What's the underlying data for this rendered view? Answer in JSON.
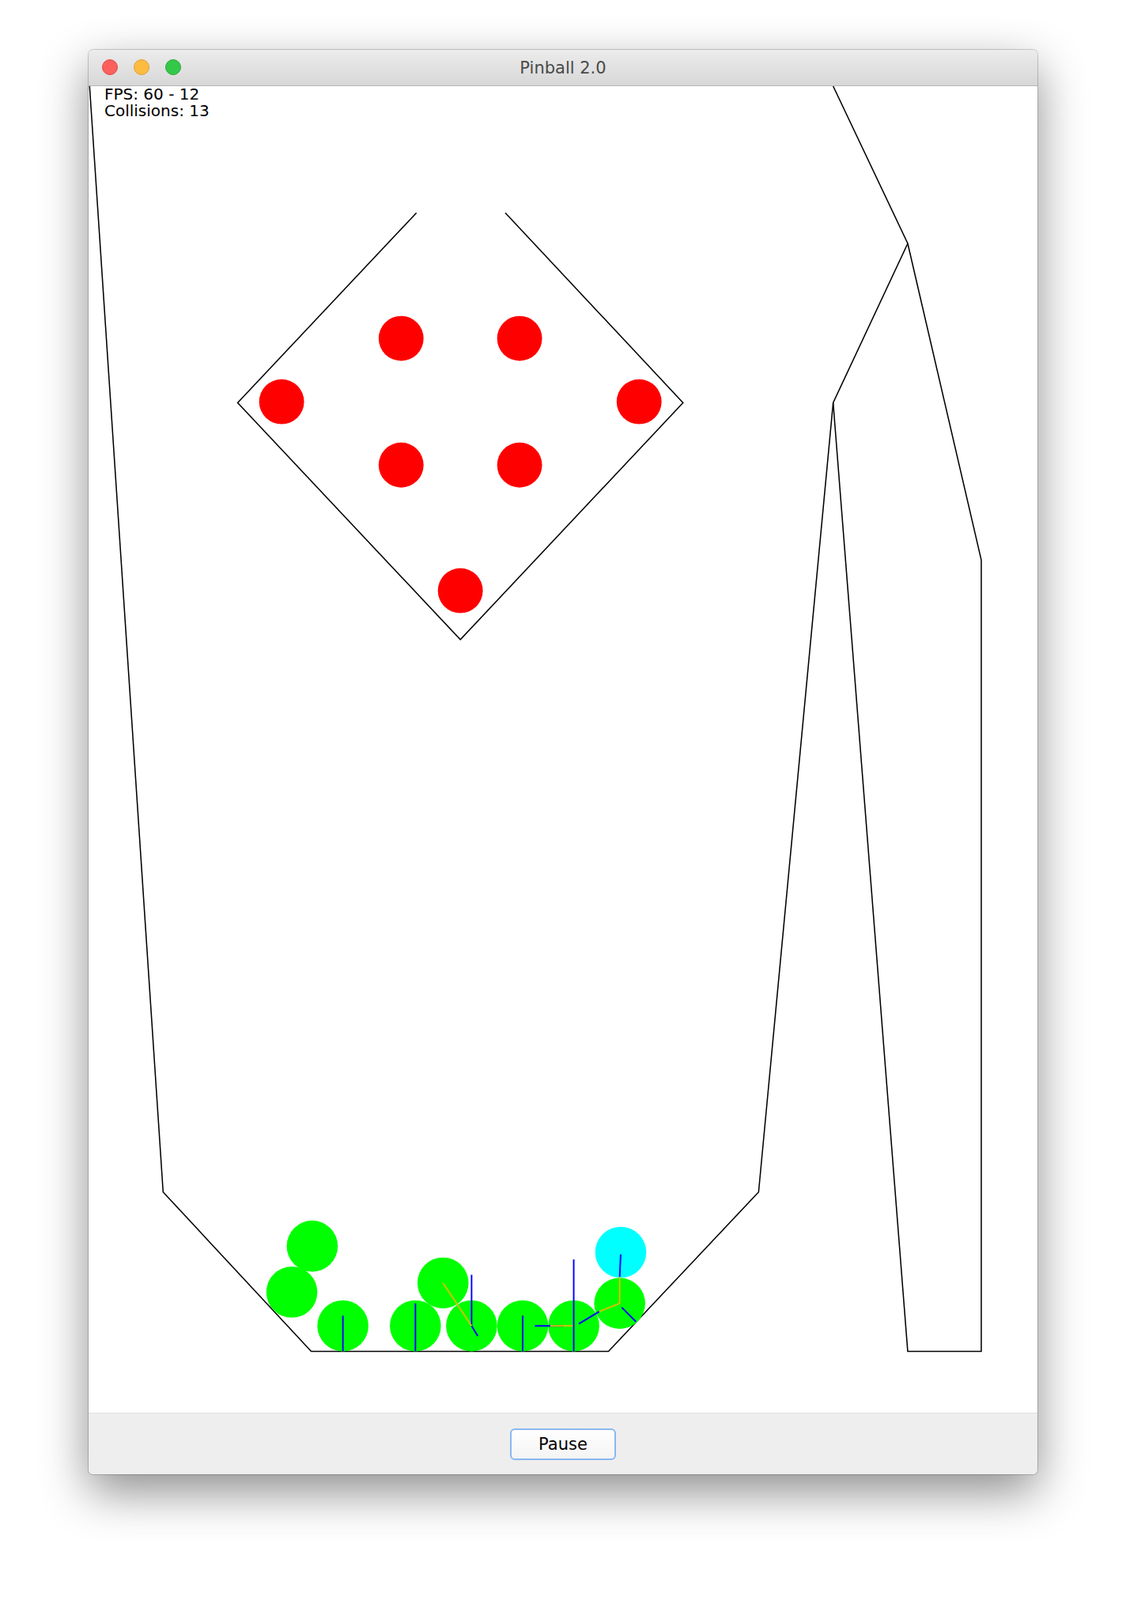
{
  "window": {
    "title": "Pinball 2.0"
  },
  "stats": {
    "fps": "FPS: 60 - 12",
    "collisions": "Collisions: 13"
  },
  "bumpers": [
    {
      "color": "#ff0000"
    },
    {
      "color": "#ff0000"
    },
    {
      "color": "#ff0000"
    },
    {
      "color": "#ff0000"
    },
    {
      "color": "#ff0000"
    },
    {
      "color": "#ff0000"
    },
    {
      "color": "#ff0000"
    }
  ],
  "balls": [
    {
      "color": "#00ff00"
    },
    {
      "color": "#00ff00"
    },
    {
      "color": "#00ff00"
    },
    {
      "color": "#00ff00"
    },
    {
      "color": "#00ff00"
    },
    {
      "color": "#00ff00"
    },
    {
      "color": "#00ff00"
    },
    {
      "color": "#00ff00"
    },
    {
      "color": "#00ff00"
    },
    {
      "color": "#00ffff"
    }
  ],
  "buttons": [
    {
      "label": "Pause"
    }
  ]
}
